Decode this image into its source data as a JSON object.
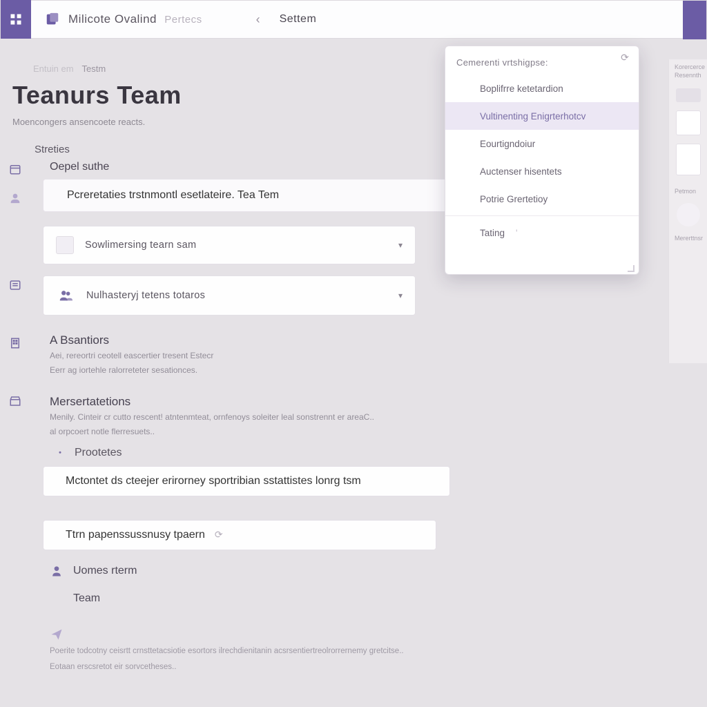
{
  "header": {
    "app_name": "Milicote Ovalind",
    "app_name_faded": "Pertecs",
    "nav_tab": "Settem"
  },
  "breadcrumb": {
    "a": "Entuin em",
    "b": "Testm"
  },
  "page": {
    "title": "Teanurs Team",
    "subtitle": "Moencongers ansencoete reacts."
  },
  "section_a_label": "Streties",
  "row_open_label": "Oepel suthe",
  "card_primary": "Pcreretaties trstnmontl esetlateire. Tea Tem",
  "card_sowring": "Sowlimersing tearn sam",
  "card_muster": "Nulhasteryj tetens totaros",
  "section_b": {
    "title": "A Bsantiors",
    "desc1": "Aei, rereortri ceotell eascertier tresent Estecr",
    "desc2": "Eerr ag iortehle ralorreteter sesationces."
  },
  "section_c": {
    "title": "Mersertatetions",
    "desc1": "Menily. Cinteir cr cutto rescent! atntenmteat, ornfenoys soleiter leal sonstrennt er areaC..",
    "desc2": "al orpcoert notle flerresuets.."
  },
  "protects_label": "Prootetes",
  "card_motent": "Mctontet ds cteejer erirorney sportribian sstattistes lonrg tsm",
  "card_tim": "Ttrn papenssussnusy tpaern",
  "uomes_label": "Uomes rterm",
  "team_label": "Team",
  "footer1": "Poerite todcotny ceisrtt crnsttetacsiotie esortors ilrechdienitanin acsrsentiertreolrorrernemy gretcitse..",
  "footer2": "Eotaan erscsretot eir sorvcetheses..",
  "dropdown": {
    "header": "Cemerenti vrtshigpse:",
    "items": [
      {
        "label": "Boplifrre ketetardion",
        "icon": "file"
      },
      {
        "label": "Vultinenting Enigrterhotcv",
        "icon": "doc",
        "highlight": true
      },
      {
        "label": "Eourtigndoiur",
        "icon": "box"
      },
      {
        "label": "Auctenser hisentets",
        "icon": "chat"
      },
      {
        "label": "Potrie Grertetioy",
        "icon": "cal"
      },
      {
        "label": "Tating",
        "icon": "note",
        "trail": "'"
      }
    ]
  },
  "right_ghost": {
    "l1": "Korercerce",
    "l2": "Resennth",
    "l3": "Petmon",
    "l4": "Mererttnsr"
  }
}
